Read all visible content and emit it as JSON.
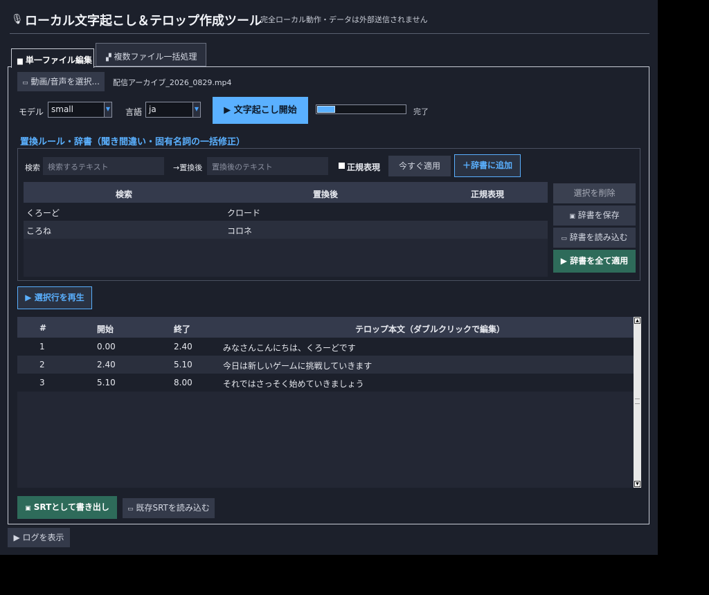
{
  "header": {
    "title": "ローカル文字起こし＆テロップ作成ツール",
    "subtitle": "完全ローカル動作・データは外部送信されません"
  },
  "tabs": [
    {
      "label": "単一ファイル編集"
    },
    {
      "label": "複数ファイル一括処理"
    }
  ],
  "file": {
    "select_label": "動画/音声を選択...",
    "name": "配信アーカイブ_2026_0829.mp4"
  },
  "controls": {
    "model_label": "モデル",
    "model_value": "small",
    "lang_label": "言語",
    "lang_value": "ja",
    "start_label": "▶ 文字起こし開始",
    "progress": 0.2,
    "status": "完了"
  },
  "rules": {
    "section_title": "置換ルール・辞書（聞き間違い・固有名詞の一括修正）",
    "search_label": "検索",
    "search_placeholder": "検索するテキスト",
    "replace_label": "→置換後",
    "replace_placeholder": "置換後のテキスト",
    "regex_label": "正規表現",
    "apply_now_label": "今すぐ適用",
    "add_label": "＋辞書に追加",
    "columns": [
      "検索",
      "置換後",
      "正規表現"
    ],
    "rows": [
      {
        "search": "くろーど",
        "replace": "クロード",
        "regex": ""
      },
      {
        "search": "ころね",
        "replace": "コロネ",
        "regex": ""
      }
    ],
    "delete_label": "選択を削除",
    "save_label": "辞書を保存",
    "load_label": "辞書を読み込む",
    "apply_all_label": "▶ 辞書を全て適用"
  },
  "play_label": "▶ 選択行を再生",
  "subs": {
    "columns": [
      "#",
      "開始",
      "終了",
      "テロップ本文（ダブルクリックで編集）"
    ],
    "rows": [
      {
        "n": "1",
        "start": "0.00",
        "end": "2.40",
        "text": "みなさんこんにちは、くろーどです"
      },
      {
        "n": "2",
        "start": "2.40",
        "end": "5.10",
        "text": "今日は新しいゲームに挑戦していきます"
      },
      {
        "n": "3",
        "start": "5.10",
        "end": "8.00",
        "text": "それではさっそく始めていきましょう"
      }
    ]
  },
  "export_label": "SRTとして書き出し",
  "import_label": "既存SRTを読み込む",
  "log_label": "▶ ログを表示",
  "colors": {
    "accent": "#5ab0ff",
    "green": "#2e6b5a",
    "bg": "#1c202b"
  }
}
